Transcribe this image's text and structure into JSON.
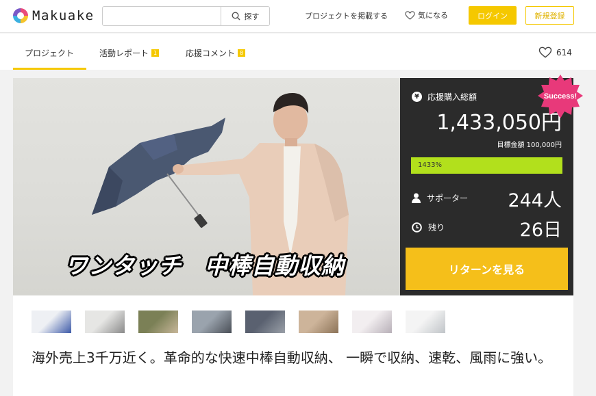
{
  "header": {
    "logo_text": "Makuake",
    "search": {
      "placeholder": "",
      "button_label": "探す"
    },
    "post_project": "プロジェクトを掲載する",
    "favorites": "気になる",
    "login": "ログイン",
    "signup": "新規登録"
  },
  "tabs": [
    {
      "label": "プロジェクト",
      "badge": ""
    },
    {
      "label": "活動レポート",
      "badge": "1"
    },
    {
      "label": "応援コメント",
      "badge": "8"
    }
  ],
  "likes_count": "614",
  "hero": {
    "caption": "ワンタッチ　中棒自動収納"
  },
  "panel": {
    "total_label": "応援購入総額",
    "total_amount": "1,433,050円",
    "goal_text": "目標金額 100,000円",
    "progress_percent": 1433,
    "progress_label": "1433%",
    "supporters_label": "サポーター",
    "supporters_value": "244人",
    "remaining_label": "残り",
    "remaining_value": "26日",
    "return_button": "リターンを見る",
    "success_badge": "Success!"
  },
  "thumbnails": [
    {
      "name": "thumb-1",
      "colors": [
        "#eef0f4",
        "#3d5aa8"
      ]
    },
    {
      "name": "thumb-2",
      "colors": [
        "#e6e6e4",
        "#8a8a8a"
      ]
    },
    {
      "name": "thumb-3",
      "colors": [
        "#7b8056",
        "#c8b79a"
      ]
    },
    {
      "name": "thumb-4",
      "colors": [
        "#9aa3ad",
        "#4a4f57"
      ]
    },
    {
      "name": "thumb-5",
      "colors": [
        "#5a6170",
        "#9aa0a8"
      ]
    },
    {
      "name": "thumb-6",
      "colors": [
        "#cdb49a",
        "#8c7358"
      ]
    },
    {
      "name": "thumb-7",
      "colors": [
        "#f2eef0",
        "#b8b0b8"
      ]
    },
    {
      "name": "thumb-8",
      "colors": [
        "#f4f4f4",
        "#c0c4c8"
      ]
    }
  ],
  "headline": "海外売上3千万近く。革命的な快速中棒自動収納、 一瞬で収納、速乾、風雨に強い。",
  "colors": {
    "accent": "#f5c800",
    "panel_bg": "#2b2b2b",
    "progress": "#b2e01c",
    "return_button": "#f5bf1a",
    "success_badge": "#e8397a"
  }
}
